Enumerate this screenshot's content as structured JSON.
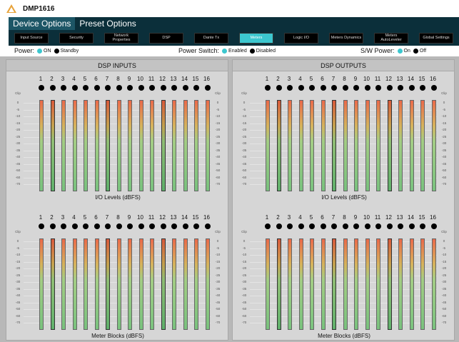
{
  "app": {
    "title": "DMP1616"
  },
  "menu": [
    {
      "label": "Device Options",
      "active": true
    },
    {
      "label": "Preset Options",
      "active": false
    }
  ],
  "nav": [
    {
      "label": "Input Source",
      "active": false
    },
    {
      "label": "Security",
      "active": false
    },
    {
      "label": "Network Properties",
      "active": false
    },
    {
      "label": "DSP",
      "active": false
    },
    {
      "label": "Dante Tx",
      "active": false
    },
    {
      "label": "Meters",
      "active": true
    },
    {
      "label": "Logic I/O",
      "active": false
    },
    {
      "label": "Meters Dynamics",
      "active": false
    },
    {
      "label": "Meters AutoLeveler",
      "active": false
    },
    {
      "label": "Global Settings",
      "active": false
    }
  ],
  "status": {
    "power": {
      "label": "Power:",
      "options": [
        "ON",
        "Standby"
      ],
      "selected": "ON"
    },
    "power_switch": {
      "label": "Power Switch:",
      "options": [
        "Enabled",
        "Disabled"
      ],
      "selected": "Enabled"
    },
    "sw_power": {
      "label": "S/W Power:",
      "options": [
        "On",
        "Off"
      ],
      "selected": "On"
    }
  },
  "panels": [
    {
      "title": "DSP INPUTS",
      "blocks": [
        {
          "caption": "I/O Levels (dBFS)"
        },
        {
          "caption": "Meter Blocks (dBFS)"
        }
      ]
    },
    {
      "title": "DSP OUTPUTS",
      "blocks": [
        {
          "caption": "I/O Levels (dBFS)"
        },
        {
          "caption": "Meter Blocks (dBFS)"
        }
      ]
    }
  ],
  "channels": [
    "1",
    "2",
    "3",
    "4",
    "5",
    "6",
    "7",
    "8",
    "9",
    "10",
    "11",
    "12",
    "13",
    "14",
    "15",
    "16"
  ],
  "scale": {
    "clip_label": "Clip",
    "ticks": [
      "0",
      "-5",
      "-10",
      "-15",
      "-20",
      "-25",
      "-30",
      "-35",
      "-40",
      "-45",
      "-50",
      "-60",
      "-70"
    ],
    "bottom_label": "-80\ndB"
  },
  "colors": {
    "menubar": "#0b2f3a",
    "accent": "#3cc7cf",
    "meter_top": "#d85a3b",
    "meter_bottom": "#5fb06b"
  }
}
